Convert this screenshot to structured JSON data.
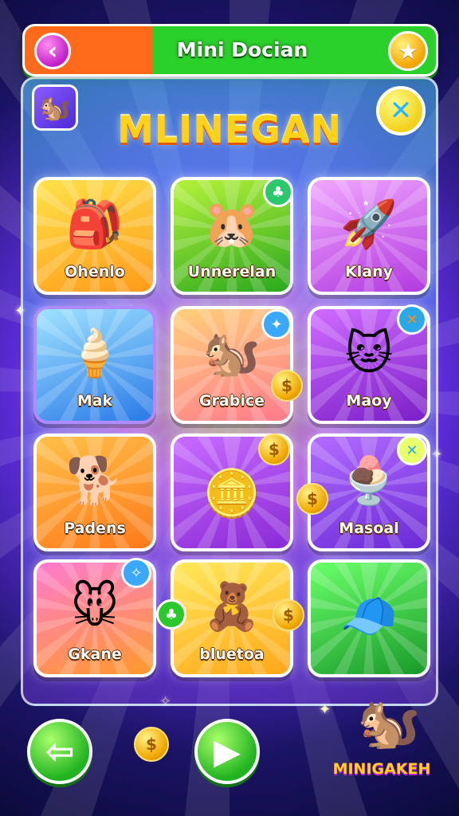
{
  "header": {
    "title": "Mini Docian",
    "back_icon": "‹",
    "star_icon": "★"
  },
  "panel": {
    "logo_text": "MLINEGAN",
    "avatar_icon": "🐿️",
    "close_icon": "✕"
  },
  "tiles": [
    {
      "label": "Ohenlo",
      "art": "🎒"
    },
    {
      "label": "Unnerelan",
      "art": "🐹"
    },
    {
      "label": "Klany",
      "art": "🚀"
    },
    {
      "label": "Mak",
      "art": "🍦"
    },
    {
      "label": "Grabice",
      "art": "🐿️"
    },
    {
      "label": "Maoy",
      "art": "🐱"
    },
    {
      "label": "Padens",
      "art": "🐕"
    },
    {
      "label": "",
      "art": "🪙"
    },
    {
      "label": "Masoal",
      "art": "🍨"
    },
    {
      "label": "Gkane",
      "art": "🐭"
    },
    {
      "label": "bluetoa",
      "art": "🧸"
    },
    {
      "label": "",
      "art": "🧢"
    }
  ],
  "nav": {
    "prev_icon": "⇦",
    "next_icon": "▶"
  },
  "branding": {
    "text": "MINIGAKEH",
    "mascot": "🐿️"
  },
  "colors": {
    "accent_green": "#2bd12b",
    "accent_orange": "#ff6a1a",
    "accent_gold": "#ffd21a"
  }
}
